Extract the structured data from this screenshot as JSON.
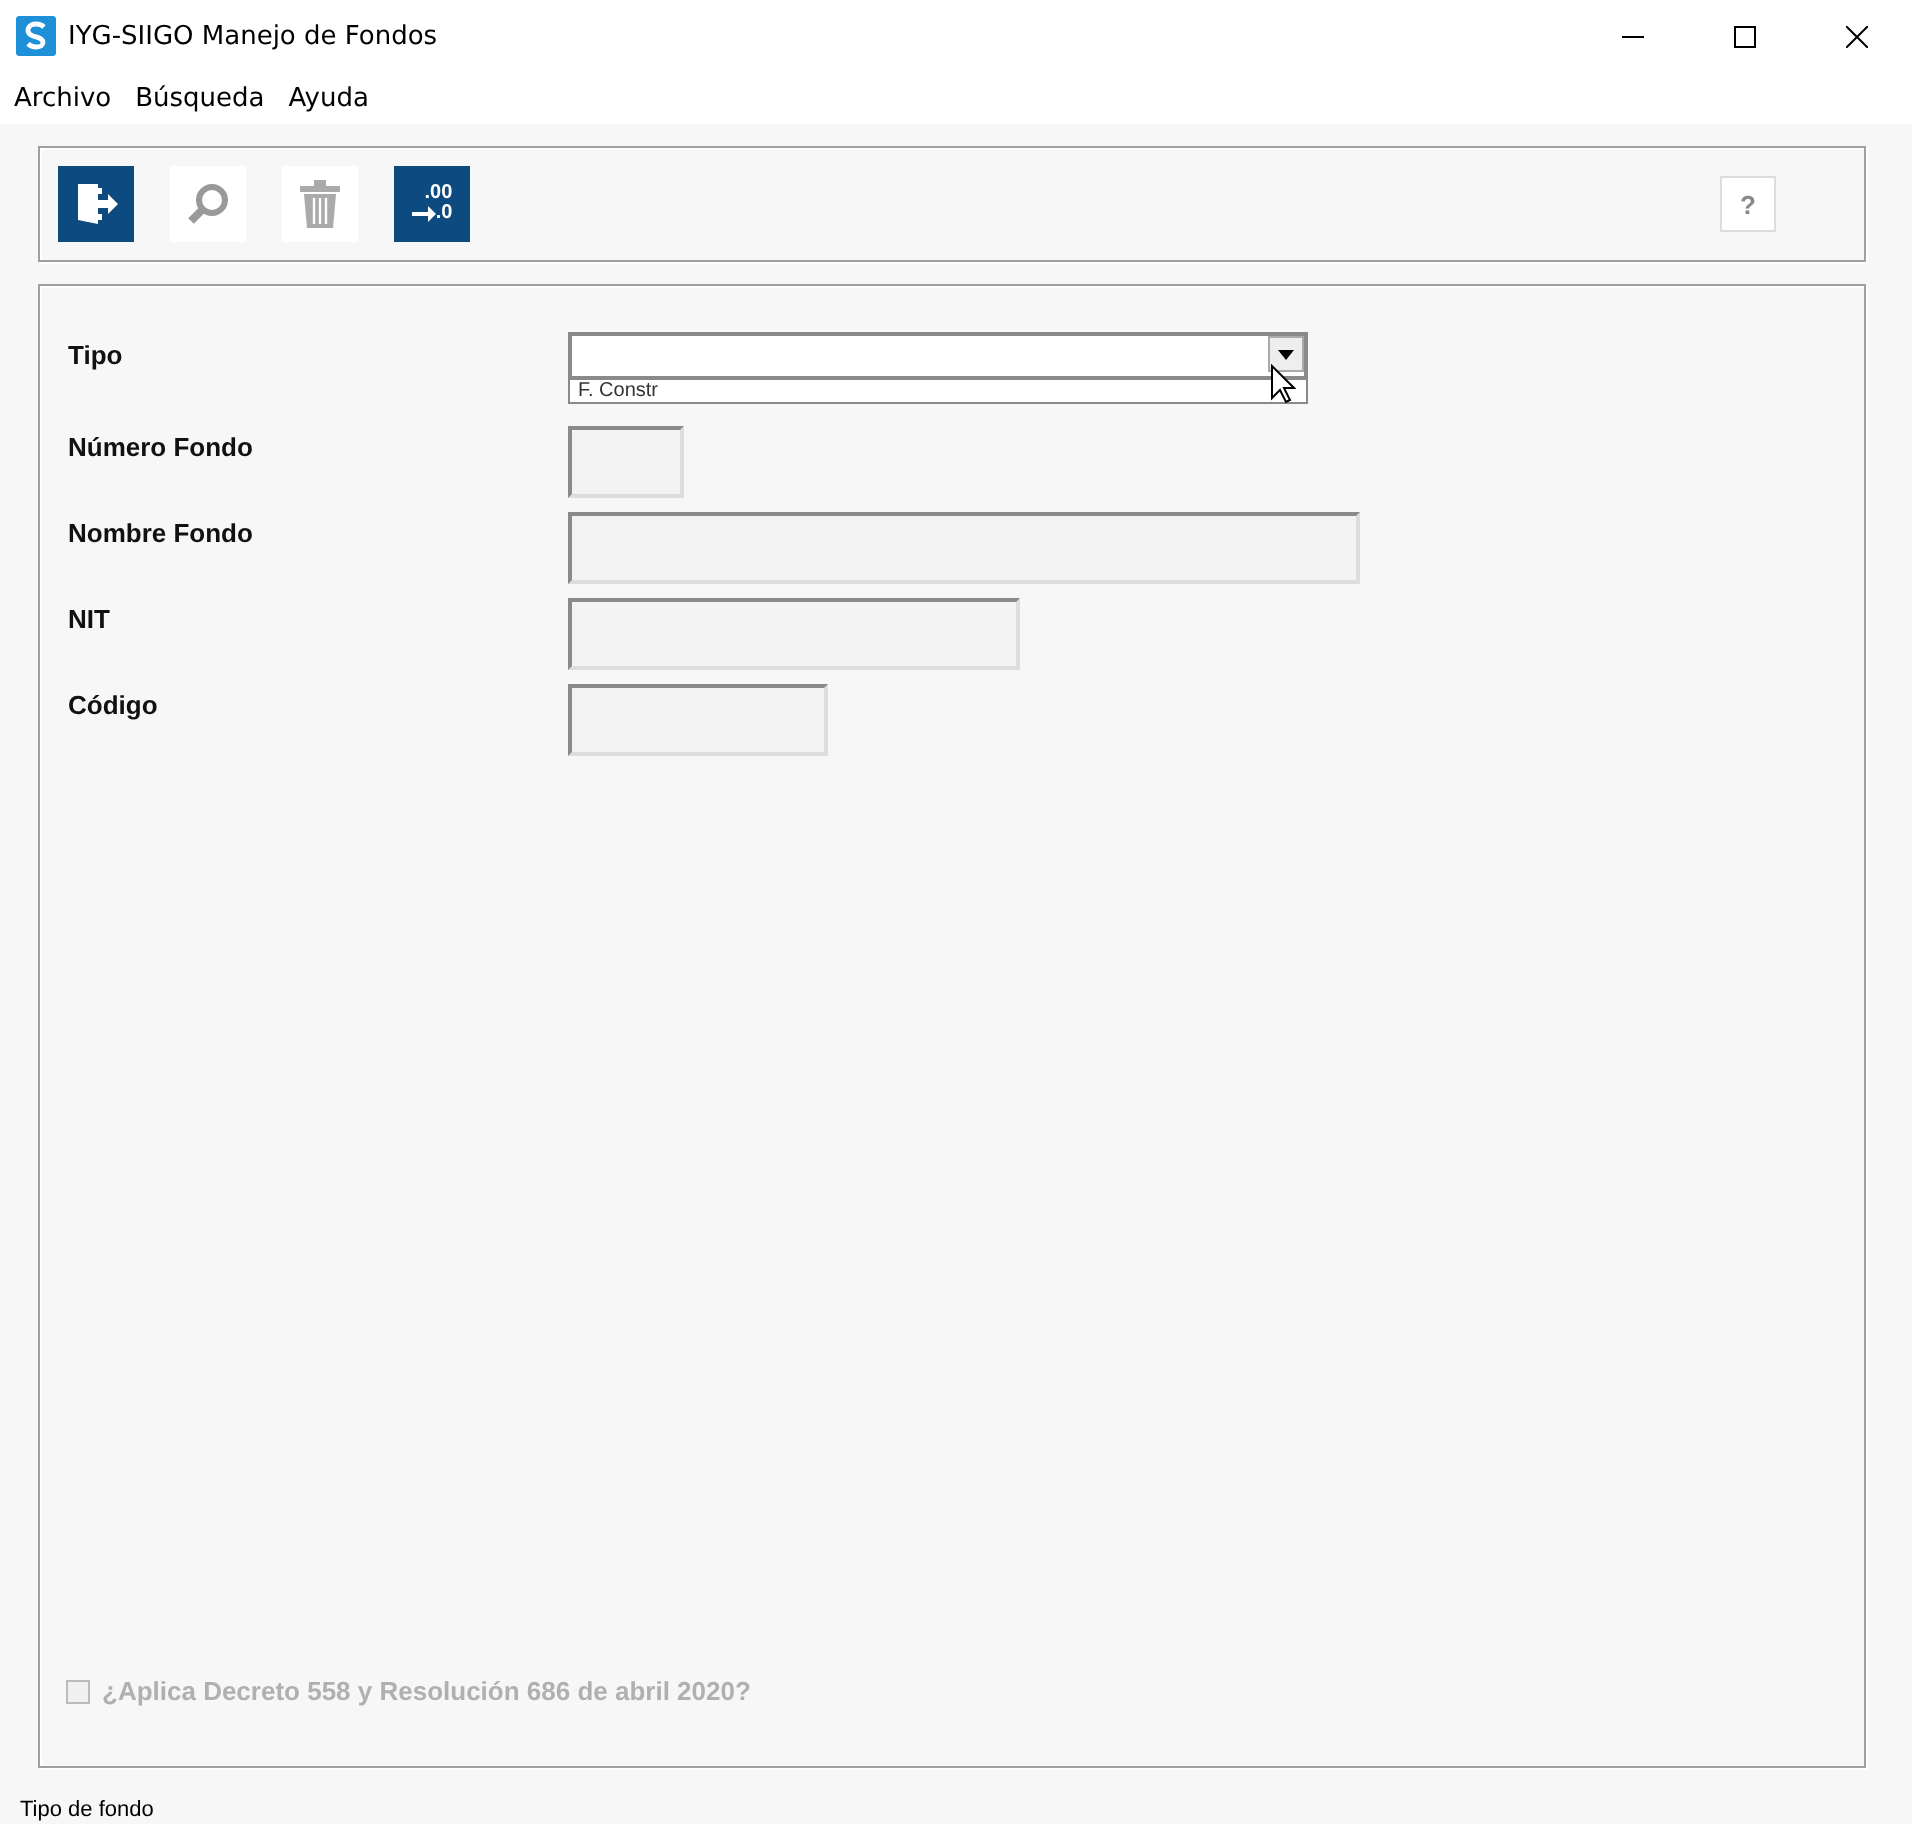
{
  "window": {
    "title": "IYG-SIIGO Manejo de Fondos"
  },
  "menu": [
    "Archivo",
    "Búsqueda",
    "Ayuda"
  ],
  "toolbar": [
    {
      "kind": "exit",
      "disabled": false
    },
    {
      "kind": "search",
      "disabled": true
    },
    {
      "kind": "delete",
      "disabled": true
    },
    {
      "kind": "decimals",
      "disabled": false,
      "top": ".00",
      "bottom": ".0"
    }
  ],
  "help_button": "?",
  "form": [
    {
      "label": "Tipo",
      "kind": "combo",
      "option": "F. Constr"
    },
    {
      "label": "Número Fondo",
      "kind": "text"
    },
    {
      "label": "Nombre Fondo",
      "kind": "text"
    },
    {
      "label": "NIT",
      "kind": "text"
    },
    {
      "label": "Código",
      "kind": "text"
    }
  ],
  "checkbox": {
    "label": "¿Aplica Decreto 558 y Resolución 686 de abril 2020?",
    "checked": false,
    "disabled": true
  },
  "status_bar": "Tipo de fondo"
}
